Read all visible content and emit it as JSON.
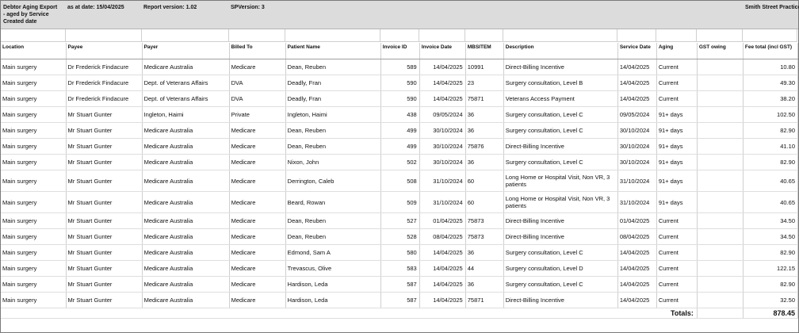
{
  "header": {
    "title": "Debtor Aging Export",
    "subtitle": " - aged by Service",
    "created_label": "Created date",
    "as_at_date": "as at date: 15/04/2025",
    "report_version": "Report version: 1.02",
    "sp_version": "SPVersion:  3",
    "practice": "Smith Street Practice"
  },
  "columns": {
    "location": "Location",
    "payee": "Payee",
    "payer": "Payer",
    "billed_to": "Billed To",
    "patient_name": "Patient Name",
    "invoice_id": "Invoice ID",
    "invoice_date": "Invoice Date",
    "mbs_item": "MBSITEM",
    "description": "Description",
    "service_date": "Service Date",
    "aging": "Aging",
    "gst_owing": "GST owing",
    "fee_total": "Fee total (incl GST)"
  },
  "rows": [
    {
      "location": "Main surgery",
      "payee": "Dr Frederick Findacure",
      "payer": "Medicare Australia",
      "billed_to": "Medicare",
      "patient": "Dean, Reuben",
      "invoice_id": "589",
      "invoice_date": "14/04/2025",
      "mbs": "10991",
      "description": "Direct-Billing Incentive",
      "service_date": "14/04/2025",
      "aging": "Current",
      "gst": "",
      "fee": "10.80"
    },
    {
      "location": "Main surgery",
      "payee": "Dr Frederick Findacure",
      "payer": "Dept. of Veterans Affairs",
      "billed_to": "DVA",
      "patient": "Deadly, Fran",
      "invoice_id": "590",
      "invoice_date": "14/04/2025",
      "mbs": "23",
      "description": "Surgery consultation, Level B",
      "service_date": "14/04/2025",
      "aging": "Current",
      "gst": "",
      "fee": "49.30"
    },
    {
      "location": "Main surgery",
      "payee": "Dr Frederick Findacure",
      "payer": "Dept. of Veterans Affairs",
      "billed_to": "DVA",
      "patient": "Deadly, Fran",
      "invoice_id": "590",
      "invoice_date": "14/04/2025",
      "mbs": "75871",
      "description": "Veterans Access Payment",
      "service_date": "14/04/2025",
      "aging": "Current",
      "gst": "",
      "fee": "38.20"
    },
    {
      "location": "Main surgery",
      "payee": "Mr Stuart Gunter",
      "payer": "Ingleton, Haimi",
      "billed_to": "Private",
      "patient": "Ingleton, Haimi",
      "invoice_id": "438",
      "invoice_date": "09/05/2024",
      "mbs": "36",
      "description": "Surgery consultation, Level C",
      "service_date": "09/05/2024",
      "aging": "91+ days",
      "gst": "",
      "fee": "102.50"
    },
    {
      "location": "Main surgery",
      "payee": "Mr Stuart Gunter",
      "payer": "Medicare Australia",
      "billed_to": "Medicare",
      "patient": "Dean, Reuben",
      "invoice_id": "499",
      "invoice_date": "30/10/2024",
      "mbs": "36",
      "description": "Surgery consultation, Level C",
      "service_date": "30/10/2024",
      "aging": "91+ days",
      "gst": "",
      "fee": "82.90"
    },
    {
      "location": "Main surgery",
      "payee": "Mr Stuart Gunter",
      "payer": "Medicare Australia",
      "billed_to": "Medicare",
      "patient": "Dean, Reuben",
      "invoice_id": "499",
      "invoice_date": "30/10/2024",
      "mbs": "75876",
      "description": "Direct-Billing Incentive",
      "service_date": "30/10/2024",
      "aging": "91+ days",
      "gst": "",
      "fee": "41.10"
    },
    {
      "location": "Main surgery",
      "payee": "Mr Stuart Gunter",
      "payer": "Medicare Australia",
      "billed_to": "Medicare",
      "patient": "Nixon, John",
      "invoice_id": "502",
      "invoice_date": "30/10/2024",
      "mbs": "36",
      "description": "Surgery consultation, Level C",
      "service_date": "30/10/2024",
      "aging": "91+ days",
      "gst": "",
      "fee": "82.90"
    },
    {
      "location": "Main surgery",
      "payee": "Mr Stuart Gunter",
      "payer": "Medicare Australia",
      "billed_to": "Medicare",
      "patient": "Derrington, Caleb",
      "invoice_id": "508",
      "invoice_date": "31/10/2024",
      "mbs": "60",
      "description": "Long Home or Hospital Visit, Non VR, 3 patients",
      "service_date": "31/10/2024",
      "aging": "91+ days",
      "gst": "",
      "fee": "40.65"
    },
    {
      "location": "Main surgery",
      "payee": "Mr Stuart Gunter",
      "payer": "Medicare Australia",
      "billed_to": "Medicare",
      "patient": "Beard, Rowan",
      "invoice_id": "509",
      "invoice_date": "31/10/2024",
      "mbs": "60",
      "description": "Long Home or Hospital Visit, Non VR, 3 patients",
      "service_date": "31/10/2024",
      "aging": "91+ days",
      "gst": "",
      "fee": "40.65"
    },
    {
      "location": "Main surgery",
      "payee": "Mr Stuart Gunter",
      "payer": "Medicare Australia",
      "billed_to": "Medicare",
      "patient": "Dean, Reuben",
      "invoice_id": "527",
      "invoice_date": "01/04/2025",
      "mbs": "75873",
      "description": "Direct-Billing Incentive",
      "service_date": "01/04/2025",
      "aging": "Current",
      "gst": "",
      "fee": "34.50"
    },
    {
      "location": "Main surgery",
      "payee": "Mr Stuart Gunter",
      "payer": "Medicare Australia",
      "billed_to": "Medicare",
      "patient": "Dean, Reuben",
      "invoice_id": "528",
      "invoice_date": "08/04/2025",
      "mbs": "75873",
      "description": "Direct-Billing Incentive",
      "service_date": "08/04/2025",
      "aging": "Current",
      "gst": "",
      "fee": "34.50"
    },
    {
      "location": "Main surgery",
      "payee": "Mr Stuart Gunter",
      "payer": "Medicare Australia",
      "billed_to": "Medicare",
      "patient": "Edmond, Sam A",
      "invoice_id": "580",
      "invoice_date": "14/04/2025",
      "mbs": "36",
      "description": "Surgery consultation, Level C",
      "service_date": "14/04/2025",
      "aging": "Current",
      "gst": "",
      "fee": "82.90"
    },
    {
      "location": "Main surgery",
      "payee": "Mr Stuart Gunter",
      "payer": "Medicare Australia",
      "billed_to": "Medicare",
      "patient": "Trevascus, Olive",
      "invoice_id": "583",
      "invoice_date": "14/04/2025",
      "mbs": "44",
      "description": "Surgery consultation, Level D",
      "service_date": "14/04/2025",
      "aging": "Current",
      "gst": "",
      "fee": "122.15"
    },
    {
      "location": "Main surgery",
      "payee": "Mr Stuart Gunter",
      "payer": "Medicare Australia",
      "billed_to": "Medicare",
      "patient": "Hardison, Leda",
      "invoice_id": "587",
      "invoice_date": "14/04/2025",
      "mbs": "36",
      "description": "Surgery consultation, Level C",
      "service_date": "14/04/2025",
      "aging": "Current",
      "gst": "",
      "fee": "82.90"
    },
    {
      "location": "Main surgery",
      "payee": "Mr Stuart Gunter",
      "payer": "Medicare Australia",
      "billed_to": "Medicare",
      "patient": "Hardison, Leda",
      "invoice_id": "587",
      "invoice_date": "14/04/2025",
      "mbs": "75871",
      "description": "Direct-Billing Incentive",
      "service_date": "14/04/2025",
      "aging": "Current",
      "gst": "",
      "fee": "32.50"
    }
  ],
  "totals": {
    "label": "Totals:",
    "gst": "",
    "fee": "878.45"
  }
}
